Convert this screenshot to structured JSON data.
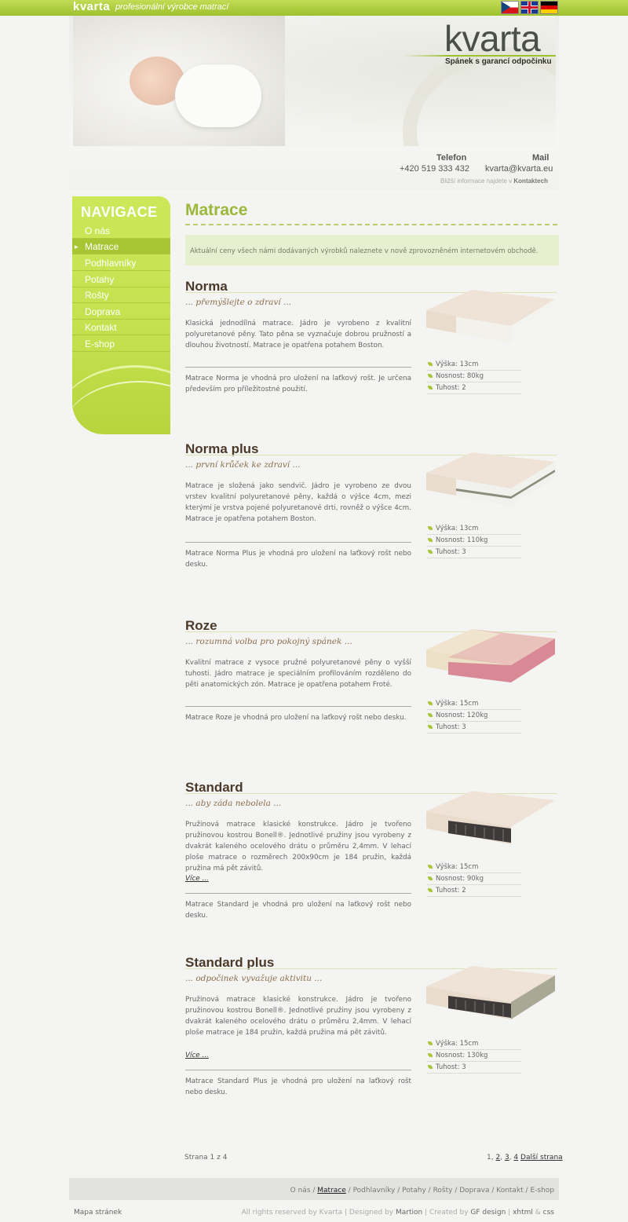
{
  "topbar": {
    "logo": "kvarta",
    "tagline": "profesionální výrobce matrací",
    "languages": [
      "Čeština",
      "English",
      "Deutsch"
    ]
  },
  "header": {
    "brand": "kvarta",
    "slogan": "Spánek s garancí odpočinku",
    "phone_label": "Telefon",
    "phone": "+420 519 333 432",
    "mail_label": "Mail",
    "mail": "kvarta@kvarta.eu",
    "info_prefix": "Bližší informace najdete v",
    "info_link": "Kontaktech"
  },
  "nav": {
    "title": "NAVIGACE",
    "items": [
      {
        "label": "O nás"
      },
      {
        "label": "Matrace",
        "active": true
      },
      {
        "label": "Podhlavníky"
      },
      {
        "label": "Potahy"
      },
      {
        "label": "Rošty"
      },
      {
        "label": "Doprava"
      },
      {
        "label": "Kontakt"
      },
      {
        "label": "E-shop"
      }
    ]
  },
  "main": {
    "title": "Matrace",
    "notice": "Aktuální ceny všech námi dodávaných výrobků naleznete v nově zprovozněném internetovém obchodě.",
    "products": [
      {
        "name": "Norma",
        "subtitle": "... přemýšlejte o zdraví ...",
        "description": "Klasická jednodílná matrace. Jádro je vyrobeno z kvalitní polyuretanové pěny. Tato pěna se vyznačuje dobrou pružností a dlouhou životností. Matrace je opatřena potahem Boston.",
        "more": "",
        "note": "Matrace Norma je vhodná pro uložení na laťkový rošt. Je určena především pro příležitostné použití.",
        "specs": [
          "Výška: 13cm",
          "Nosnost: 80kg",
          "Tuhost: 2"
        ],
        "core_color": "#f3f3f0"
      },
      {
        "name": "Norma plus",
        "subtitle": "... první krůček ke zdraví ...",
        "description": "Matrace je složená jako sendvič. Jádro je vyrobeno ze dvou vrstev kvalitní polyuretanové pěny, každá o výšce 4cm, mezi kterými je vrstva pojené polyuretanové drti, rovněž o výšce 4cm. Matrace je opatřena potahem Boston.",
        "more": "",
        "note": "Matrace Norma Plus je vhodná pro uložení na laťkový rošt nebo desku.",
        "specs": [
          "Výška: 13cm",
          "Nosnost: 110kg",
          "Tuhost: 3"
        ],
        "core_color": "#f1f1ee"
      },
      {
        "name": "Roze",
        "subtitle": "... rozumná volba pro pokojný spánek ...",
        "description": "Kvalitní matrace z vysoce pružné polyuretanové pěny o vyšší tuhosti. Jádro matrace je speciálním profilováním rozděleno do pěti anatomických zón. Matrace je opatřena potahem Froté.",
        "more": "",
        "note": "Matrace Roze je vhodná pro uložení na laťkový rošt nebo desku.",
        "specs": [
          "Výška: 15cm",
          "Nosnost: 120kg",
          "Tuhost: 3"
        ],
        "core_color": "#d98896"
      },
      {
        "name": "Standard",
        "subtitle": "... aby záda nebolela ...",
        "description": "Pružinová matrace klasické konstrukce. Jádro je tvořeno pružinovou kostrou Bonell®. Jednotlivé pružiny jsou vyrobeny z dvakrát kaleného ocelového drátu o průměru 2,4mm. V lehací ploše matrace o rozměrech 200x90cm je 184 pružin, každá pružina má pět závitů.",
        "more": "Více ...",
        "note": "Matrace Standard je vhodná pro uložení na laťkový rošt nebo desku.",
        "specs": [
          "Výška: 15cm",
          "Nosnost: 90kg",
          "Tuhost: 2"
        ],
        "core_color": "#3e3a3a"
      },
      {
        "name": "Standard plus",
        "subtitle": "... odpočinek vyvažuje aktivitu ...",
        "description": "Pružinová matrace klasické konstrukce. Jádro je tvořeno pružinovou kostrou Bonell®. Jednotlivé pružiny jsou vyrobeny z dvakrát kaleného ocelového drátu o průměru 2,4mm. V lehací ploše matrace je 184 pružin, každá pružina má pět závitů.",
        "more": "Více ...",
        "note": "Matrace Standard Plus je vhodná pro uložení na laťkový rošt nebo desku.",
        "specs": [
          "Výška: 15cm",
          "Nosnost: 130kg",
          "Tuhost: 3"
        ],
        "core_color": "#3e3a3a"
      }
    ],
    "pager": {
      "status": "Strana 1 z 4",
      "current": "1",
      "pages": [
        "2",
        "3",
        "4"
      ],
      "next": "Další strana"
    }
  },
  "footer": {
    "links": [
      "O nás",
      "Matrace",
      "Podhlavníky",
      "Potahy",
      "Rošty",
      "Doprava",
      "Kontakt",
      "E-shop"
    ],
    "sitemap": "Mapa stránek",
    "rights": "All rights reserved by Kvarta",
    "designed_by_label": "Designed by",
    "designed_by": "Martion",
    "created_by_label": "Created by",
    "created_by": "GF design",
    "tech1": "xhtml",
    "tech_amp": "&",
    "tech2": "css"
  },
  "colors": {
    "accent_green": "#9ec12e",
    "title_green": "#9cb83a",
    "heading_brown": "#4b3a2a",
    "subtitle_brown": "#8c6e4b"
  }
}
